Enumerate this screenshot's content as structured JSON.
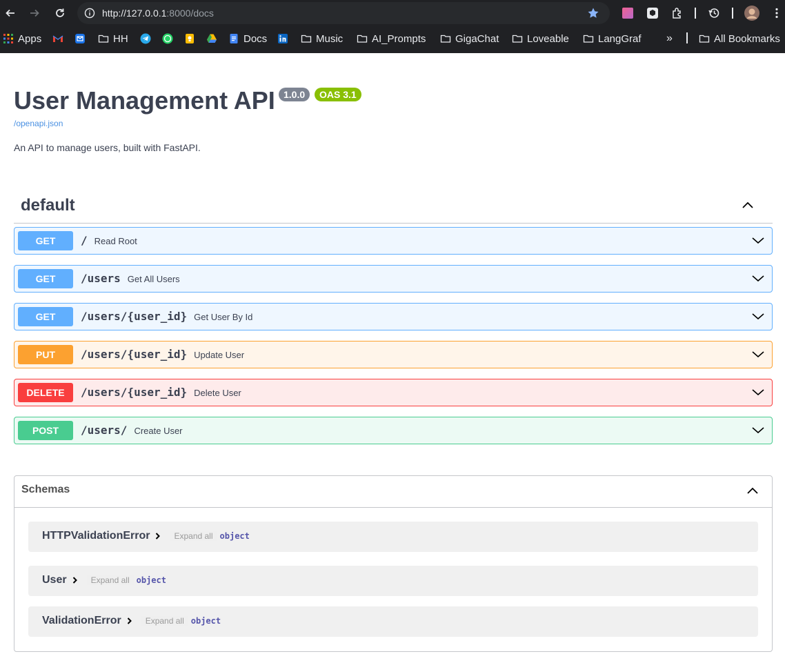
{
  "browser": {
    "url_host": "http://127.0.0.1",
    "url_rest": ":8000/docs",
    "bookmarks": [
      {
        "label": "Apps",
        "icon": "apps-grid-icon"
      },
      {
        "label": "",
        "icon": "gmail-icon"
      },
      {
        "label": "",
        "icon": "mail-icon"
      },
      {
        "label": "HH",
        "icon": "folder-icon"
      },
      {
        "label": "",
        "icon": "telegram-icon"
      },
      {
        "label": "",
        "icon": "whatsapp-icon"
      },
      {
        "label": "",
        "icon": "keep-icon"
      },
      {
        "label": "",
        "icon": "drive-icon"
      },
      {
        "label": "Docs",
        "icon": "docs-icon"
      },
      {
        "label": "",
        "icon": "linkedin-icon"
      },
      {
        "label": "Music",
        "icon": "folder-icon"
      },
      {
        "label": "AI_Prompts",
        "icon": "folder-icon"
      },
      {
        "label": "GigaChat",
        "icon": "folder-icon"
      },
      {
        "label": "Loveable",
        "icon": "folder-icon"
      },
      {
        "label": "LangGraf",
        "icon": "folder-icon"
      }
    ],
    "more": "»",
    "all_bookmarks": "All Bookmarks"
  },
  "info": {
    "title": "User Management API",
    "version": "1.0.0",
    "oas": "OAS 3.1",
    "spec_link": "/openapi.json",
    "description": "An API to manage users, built with FastAPI."
  },
  "tag": {
    "name": "default"
  },
  "operations": [
    {
      "method": "GET",
      "path": "/",
      "summary": "Read Root"
    },
    {
      "method": "GET",
      "path": "/users",
      "summary": "Get All Users"
    },
    {
      "method": "GET",
      "path": "/users/{user_id}",
      "summary": "Get User By Id"
    },
    {
      "method": "PUT",
      "path": "/users/{user_id}",
      "summary": "Update User"
    },
    {
      "method": "DELETE",
      "path": "/users/{user_id}",
      "summary": "Delete User"
    },
    {
      "method": "POST",
      "path": "/users/",
      "summary": "Create User"
    }
  ],
  "schemas": {
    "label": "Schemas",
    "models": [
      {
        "name": "HTTPValidationError",
        "expand": "Expand all",
        "type": "object"
      },
      {
        "name": "User",
        "expand": "Expand all",
        "type": "object"
      },
      {
        "name": "ValidationError",
        "expand": "Expand all",
        "type": "object"
      }
    ]
  },
  "colors": {
    "get": "#61affe",
    "put": "#fca130",
    "delete": "#f93e3e",
    "post": "#49cc90",
    "chrome": "#202124"
  }
}
